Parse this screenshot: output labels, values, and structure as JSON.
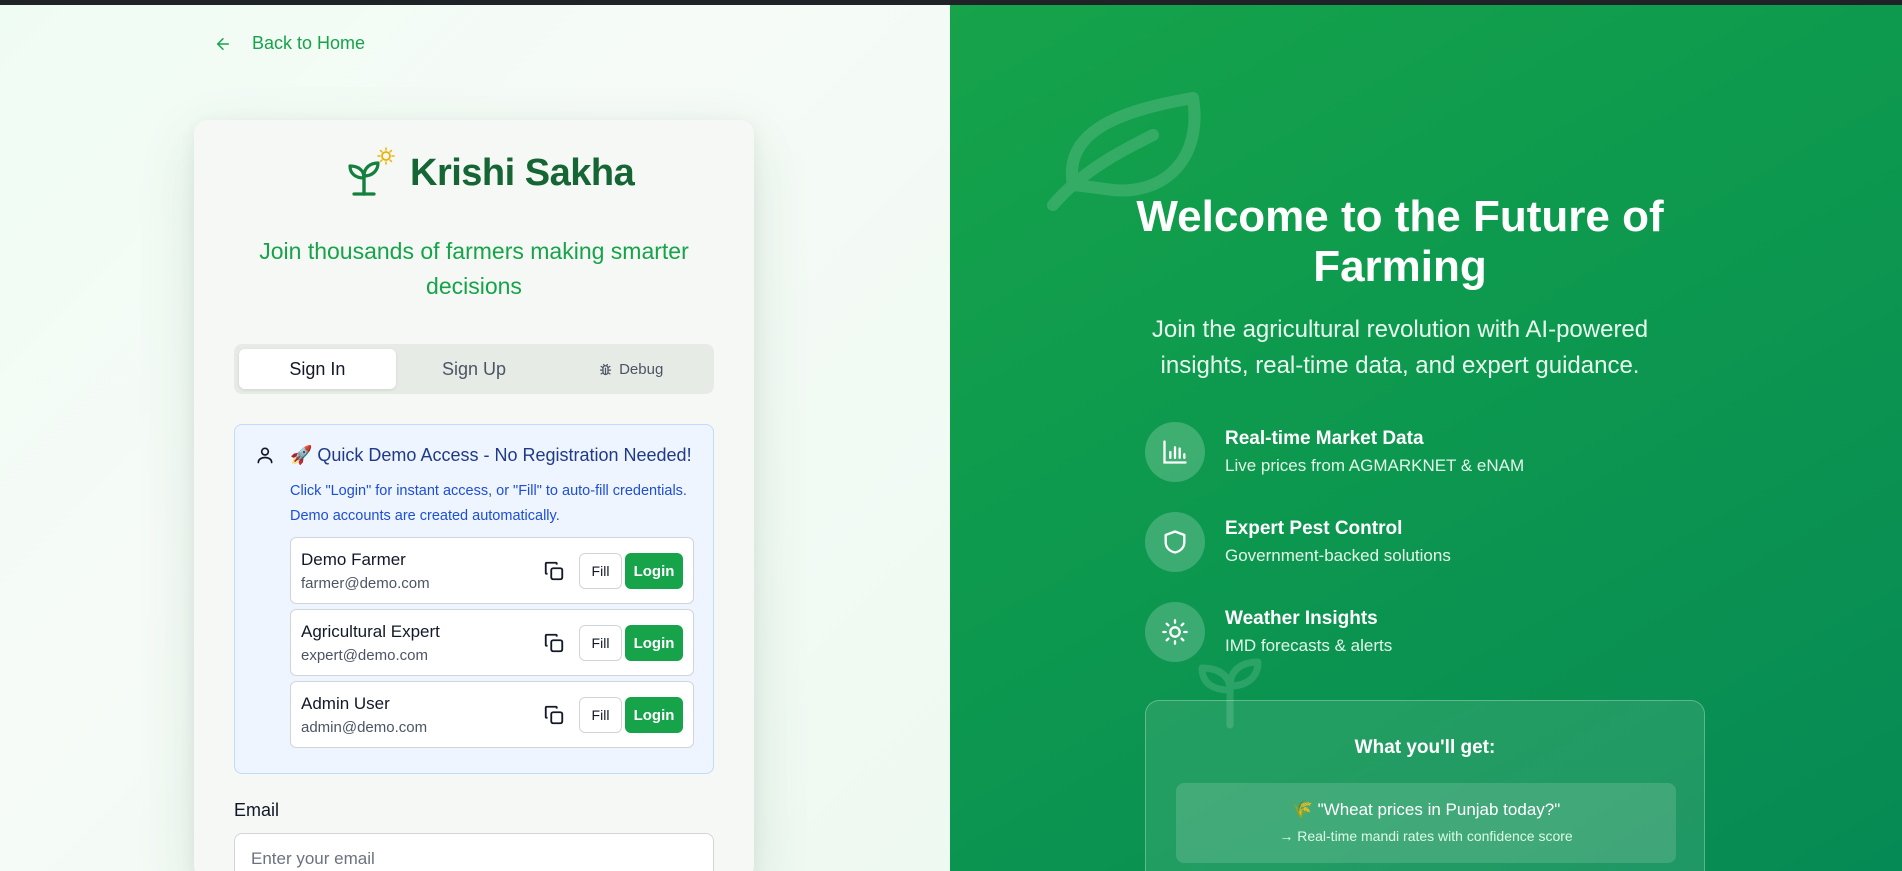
{
  "nav": {
    "back_label": "Back to Home"
  },
  "brand": {
    "name": "Krishi Sakha",
    "tagline": "Join thousands of farmers making smarter decisions"
  },
  "tabs": [
    {
      "label": "Sign In",
      "active": true
    },
    {
      "label": "Sign Up",
      "active": false
    },
    {
      "label": "Debug",
      "icon": "bug-icon",
      "active": false
    }
  ],
  "demo": {
    "title": "🚀 Quick Demo Access - No Registration Needed!",
    "description": "Click \"Login\" for instant access, or \"Fill\" to auto-fill credentials. Demo accounts are created automatically.",
    "accounts": [
      {
        "name": "Demo Farmer",
        "email": "farmer@demo.com",
        "fill_label": "Fill",
        "login_label": "Login"
      },
      {
        "name": "Agricultural Expert",
        "email": "expert@demo.com",
        "fill_label": "Fill",
        "login_label": "Login"
      },
      {
        "name": "Admin User",
        "email": "admin@demo.com",
        "fill_label": "Fill",
        "login_label": "Login"
      }
    ]
  },
  "form": {
    "email_label": "Email",
    "email_placeholder": "Enter your email",
    "email_value": ""
  },
  "hero": {
    "title": "Welcome to the Future of Farming",
    "subtitle": "Join the agricultural revolution with AI-powered insights, real-time data, and expert guidance."
  },
  "features": [
    {
      "icon": "bar-chart-icon",
      "title": "Real-time Market Data",
      "description": "Live prices from AGMARKNET & eNAM"
    },
    {
      "icon": "shield-icon",
      "title": "Expert Pest Control",
      "description": "Government-backed solutions"
    },
    {
      "icon": "sun-icon",
      "title": "Weather Insights",
      "description": "IMD forecasts & alerts"
    }
  ],
  "benefits": {
    "title": "What you'll get:",
    "items": [
      {
        "query": "🌾 \"Wheat prices in Punjab today?\"",
        "answer": "→ Real-time mandi rates with confidence score"
      }
    ]
  },
  "colors": {
    "brand_green": "#16a34a",
    "brand_dark": "#166534",
    "demo_bg": "#eef5fe",
    "demo_text": "#1d4ed8"
  }
}
